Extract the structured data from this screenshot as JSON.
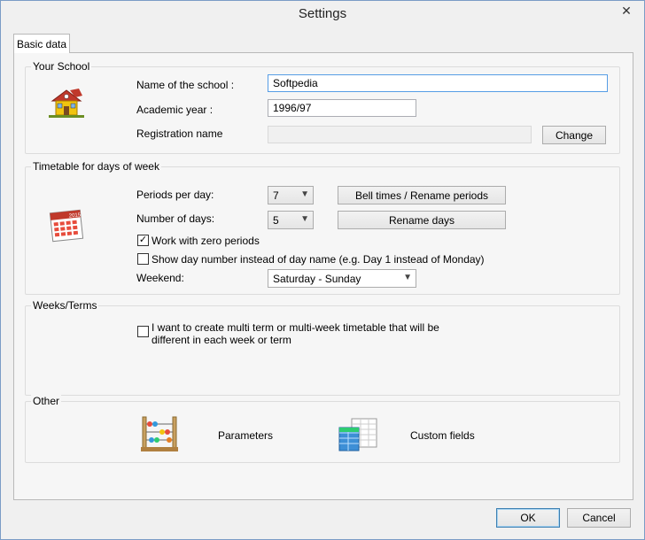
{
  "window": {
    "title": "Settings",
    "close_glyph": "✕"
  },
  "tabs": [
    {
      "label": "Basic data"
    }
  ],
  "school": {
    "group_title": "Your School",
    "name_label": "Name of the school :",
    "name_value": "Softpedia",
    "year_label": "Academic year :",
    "year_value": "1996/97",
    "registration_label": "Registration name",
    "registration_value": "",
    "change_button": "Change",
    "icon": "school-house-icon"
  },
  "timetable": {
    "group_title": "Timetable for days of week",
    "periods_label": "Periods per day:",
    "periods_value": "7",
    "days_label": "Number of days:",
    "days_value": "5",
    "bell_button": "Bell times / Rename periods",
    "rename_days_button": "Rename days",
    "zero_periods_label": "Work with zero periods",
    "zero_periods_checked": true,
    "day_number_label": "Show day number instead of day name (e.g. Day 1 instead of Monday)",
    "day_number_checked": false,
    "weekend_label": "Weekend:",
    "weekend_value": "Saturday - Sunday",
    "calendar_year": "2015",
    "icon": "calendar-icon"
  },
  "weeks": {
    "group_title": "Weeks/Terms",
    "multi_term_label_line1": "I want to create multi term or multi-week timetable that will be",
    "multi_term_label_line2": "different in each week or term",
    "multi_term_checked": false
  },
  "other": {
    "group_title": "Other",
    "parameters_label": "Parameters",
    "custom_fields_label": "Custom fields",
    "parameters_icon": "abacus-icon",
    "custom_fields_icon": "table-icon"
  },
  "footer": {
    "ok_label": "OK",
    "cancel_label": "Cancel"
  },
  "colors": {
    "accent": "#569de5",
    "border": "#acacac"
  }
}
